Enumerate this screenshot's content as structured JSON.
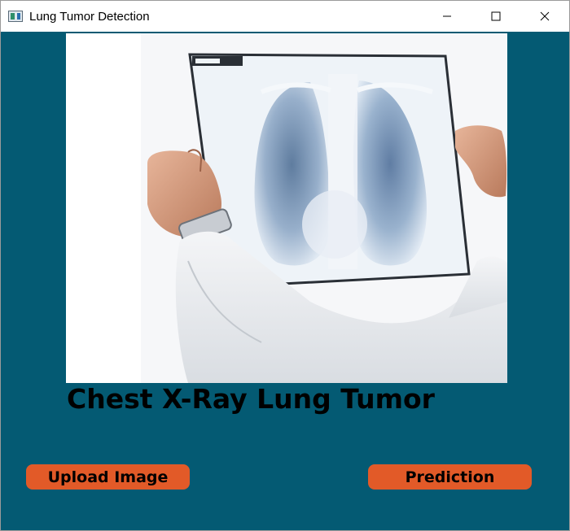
{
  "window": {
    "title": "Lung Tumor Detection",
    "controls": [
      "minimize-icon",
      "maximize-icon",
      "close-icon"
    ]
  },
  "colors": {
    "background": "#045a73",
    "button": "#e25a28",
    "heading": "#000000"
  },
  "main": {
    "image_description": "doctor holding chest x-ray",
    "heading": "Chest X-Ray Lung Tumor",
    "upload_label": "Upload Image",
    "predict_label": "Prediction"
  }
}
